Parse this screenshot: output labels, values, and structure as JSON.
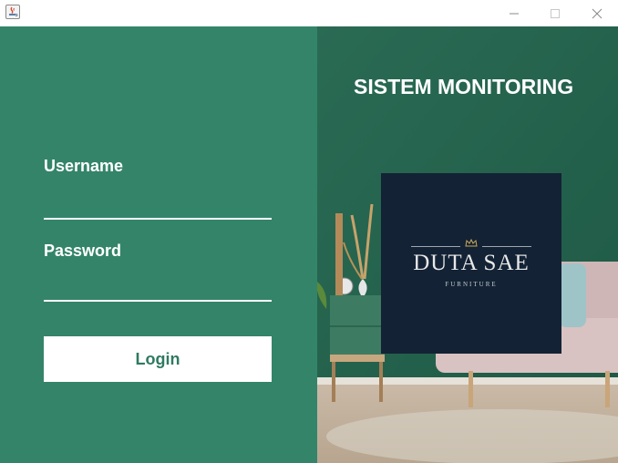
{
  "window": {
    "icon": "java-icon",
    "controls": [
      "minimize-icon",
      "maximize-icon",
      "close-icon"
    ]
  },
  "header": {
    "title": "SISTEM MONITORING"
  },
  "form": {
    "username_label": "Username",
    "username_value": "",
    "password_label": "Password",
    "password_value": "",
    "login_label": "Login"
  },
  "logo": {
    "name": "DUTA SAE",
    "subtitle": "FURNITURE"
  },
  "colors": {
    "left_panel": "#34846a",
    "right_wall": "#2b6a52",
    "logo_bg": "#132235",
    "button_bg": "#ffffff",
    "button_text": "#2f7a60"
  }
}
